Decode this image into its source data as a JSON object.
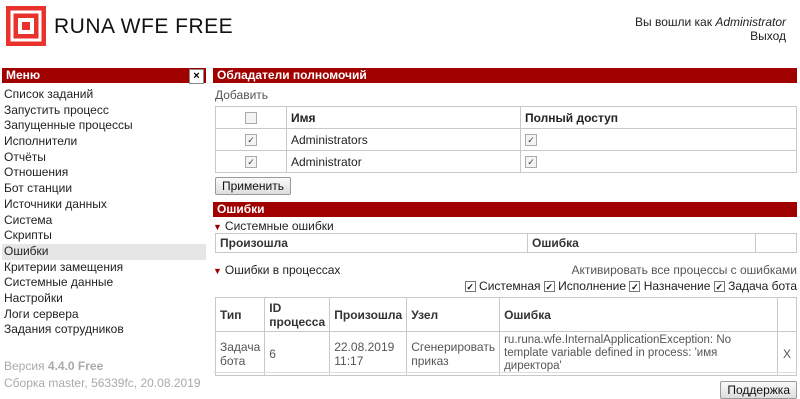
{
  "header": {
    "brand": "RUNA WFE FREE",
    "logged_in_prefix": "Вы вошли как",
    "username": "Administrator",
    "logout": "Выход"
  },
  "menu": {
    "title": "Меню",
    "close": "×",
    "items": [
      "Список заданий",
      "Запустить процесс",
      "Запущенные процессы",
      "Исполнители",
      "Отчёты",
      "Отношения",
      "Бот станции",
      "Источники данных",
      "Система",
      "Скрипты",
      "Ошибки",
      "Критерии замещения",
      "Системные данные",
      "Настройки",
      "Логи сервера",
      "Задания сотрудников"
    ],
    "version_prefix": "Версия ",
    "version": "4.4.0 Free",
    "build": "Сборка master, 56339fc, 20.08.2019"
  },
  "owners": {
    "title": "Обладатели полномочий",
    "add": "Добавить",
    "col_name": "Имя",
    "col_full": "Полный доступ",
    "rows": [
      {
        "name": "Administrators"
      },
      {
        "name": "Administrator"
      }
    ],
    "apply": "Применить"
  },
  "errors": {
    "title": "Ошибки",
    "system_errors": "Системные ошибки",
    "col_occurred": "Произошла",
    "col_error": "Ошибка",
    "process_errors": "Ошибки в процессах",
    "activate_all": "Активировать все процессы с ошибками",
    "filters": [
      "Системная",
      "Исполнение",
      "Назначение",
      "Задача бота"
    ],
    "headers": [
      "Тип",
      "ID процесса",
      "Произошла",
      "Узел",
      "Ошибка"
    ],
    "row": {
      "type": "Задача бота",
      "id": "6",
      "date": "22.08.2019 11:17",
      "node": "Сгенерировать приказ",
      "message": "ru.runa.wfe.InternalApplicationException: No template variable defined in process: 'имя директора'",
      "remove": "X"
    },
    "support": "Поддержка"
  },
  "colors": {
    "accent": "#a00000"
  }
}
